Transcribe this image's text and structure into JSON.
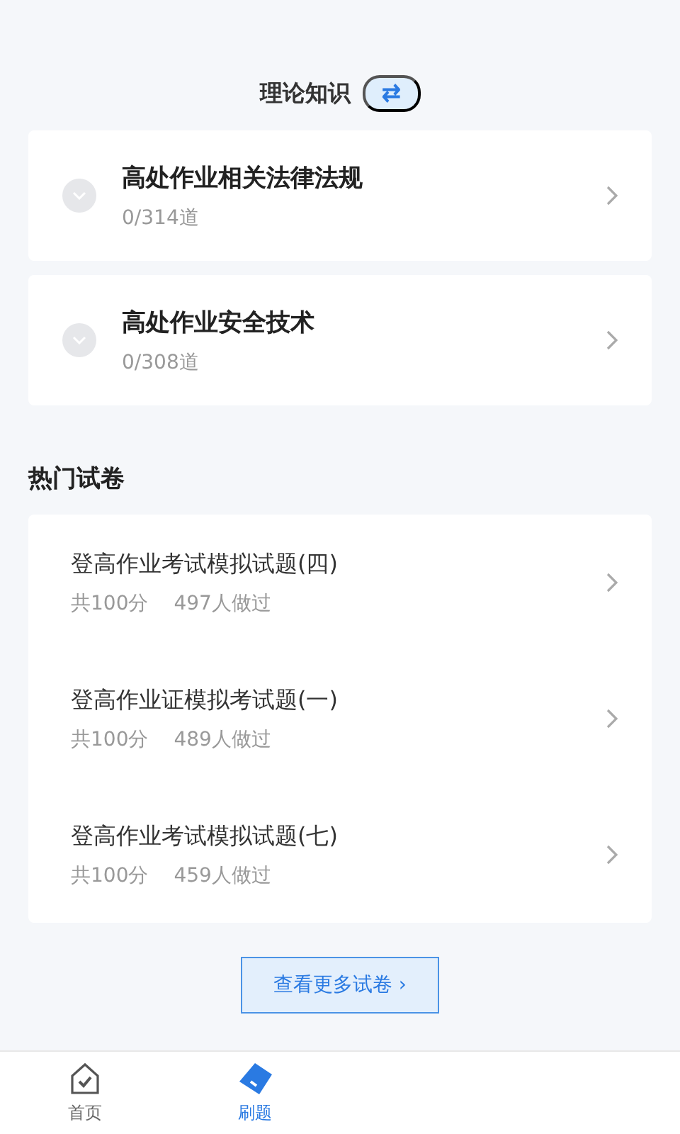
{
  "header": {
    "title": "理论知识",
    "switch_icon": "⇄"
  },
  "chapters": [
    {
      "title": "高处作业相关法律法规",
      "progress": "0/314道",
      "expanded": false
    },
    {
      "title": "高处作业安全技术",
      "progress": "0/308道",
      "expanded": false
    }
  ],
  "hot_papers": {
    "title": "热门试卷",
    "items": [
      {
        "title": "登高作业考试模拟试题(四)",
        "score": "共100分",
        "takers": "497人做过"
      },
      {
        "title": "登高作业证模拟考试题(一)",
        "score": "共100分",
        "takers": "489人做过"
      },
      {
        "title": "登高作业考试模拟试题(七)",
        "score": "共100分",
        "takers": "459人做过"
      }
    ]
  },
  "more_button": {
    "label": "查看更多试卷 ›"
  },
  "tab_bar": [
    {
      "label": "首页",
      "kind": "home",
      "selected": false
    },
    {
      "label": "刷题",
      "kind": "practice",
      "selected": true
    }
  ]
}
